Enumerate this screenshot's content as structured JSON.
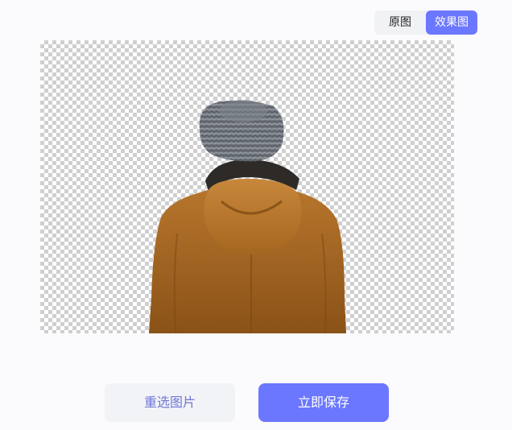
{
  "toggle": {
    "original_label": "原图",
    "effect_label": "效果图"
  },
  "buttons": {
    "reselect_label": "重选图片",
    "save_label": "立即保存"
  },
  "colors": {
    "accent": "#6b77ff",
    "background": "#fbfbfd",
    "secondary_button_bg": "#f2f3f7",
    "secondary_button_text": "#6e77d8"
  }
}
